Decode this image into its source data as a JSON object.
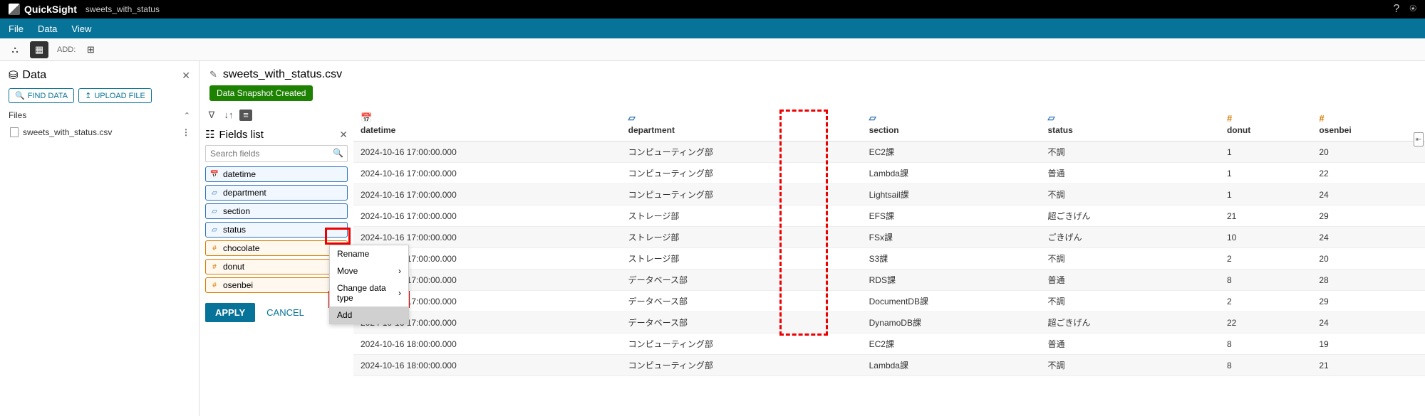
{
  "topbar": {
    "product": "QuickSight",
    "tab": "sweets_with_status"
  },
  "menu": {
    "file": "File",
    "data": "Data",
    "view": "View"
  },
  "toolbar": {
    "add_label": "ADD:"
  },
  "data_panel": {
    "title": "Data",
    "find": "FIND DATA",
    "upload": "UPLOAD FILE",
    "files_label": "Files",
    "file": "sweets_with_status.csv"
  },
  "content": {
    "filename": "sweets_with_status.csv",
    "badge": "Data Snapshot Created"
  },
  "fields": {
    "title": "Fields list",
    "search_placeholder": "Search fields",
    "items": [
      {
        "name": "datetime",
        "type": "date"
      },
      {
        "name": "department",
        "type": "str"
      },
      {
        "name": "section",
        "type": "str"
      },
      {
        "name": "status",
        "type": "str"
      },
      {
        "name": "chocolate",
        "type": "num"
      },
      {
        "name": "donut",
        "type": "num"
      },
      {
        "name": "osenbei",
        "type": "num"
      }
    ],
    "apply": "APPLY",
    "cancel": "CANCEL"
  },
  "context_menu": {
    "rename": "Rename",
    "move": "Move",
    "change": "Change data type",
    "add": "Add"
  },
  "table": {
    "columns": [
      {
        "name": "datetime",
        "icon": "📅",
        "cls": "blue"
      },
      {
        "name": "department",
        "icon": "▱",
        "cls": "blue"
      },
      {
        "name": "section",
        "icon": "▱",
        "cls": "blue"
      },
      {
        "name": "status",
        "icon": "▱",
        "cls": "blue"
      },
      {
        "name": "",
        "icon": "",
        "cls": ""
      },
      {
        "name": "donut",
        "icon": "#",
        "cls": "orange"
      },
      {
        "name": "osenbei",
        "icon": "#",
        "cls": "orange"
      }
    ],
    "rows": [
      [
        "2024-10-16 17:00:00.000",
        "コンピューティング部",
        "EC2課",
        "不調",
        "",
        "1",
        "20"
      ],
      [
        "2024-10-16 17:00:00.000",
        "コンピューティング部",
        "Lambda課",
        "普通",
        "",
        "1",
        "22"
      ],
      [
        "2024-10-16 17:00:00.000",
        "コンピューティング部",
        "Lightsail課",
        "不調",
        "",
        "1",
        "24"
      ],
      [
        "2024-10-16 17:00:00.000",
        "ストレージ部",
        "EFS課",
        "超ごきげん",
        "",
        "21",
        "29"
      ],
      [
        "2024-10-16 17:00:00.000",
        "ストレージ部",
        "FSx課",
        "ごきげん",
        "",
        "10",
        "24"
      ],
      [
        "2024-10-16 17:00:00.000",
        "ストレージ部",
        "S3課",
        "不調",
        "",
        "2",
        "20"
      ],
      [
        "2024-10-16 17:00:00.000",
        "データベース部",
        "RDS課",
        "普通",
        "",
        "8",
        "28"
      ],
      [
        "2024-10-16 17:00:00.000",
        "データベース部",
        "DocumentDB課",
        "不調",
        "",
        "2",
        "29"
      ],
      [
        "2024-10-16 17:00:00.000",
        "データベース部",
        "DynamoDB課",
        "超ごきげん",
        "",
        "22",
        "24"
      ],
      [
        "2024-10-16 18:00:00.000",
        "コンピューティング部",
        "EC2課",
        "普通",
        "",
        "8",
        "19"
      ],
      [
        "2024-10-16 18:00:00.000",
        "コンピューティング部",
        "Lambda課",
        "不調",
        "",
        "8",
        "21"
      ]
    ]
  }
}
